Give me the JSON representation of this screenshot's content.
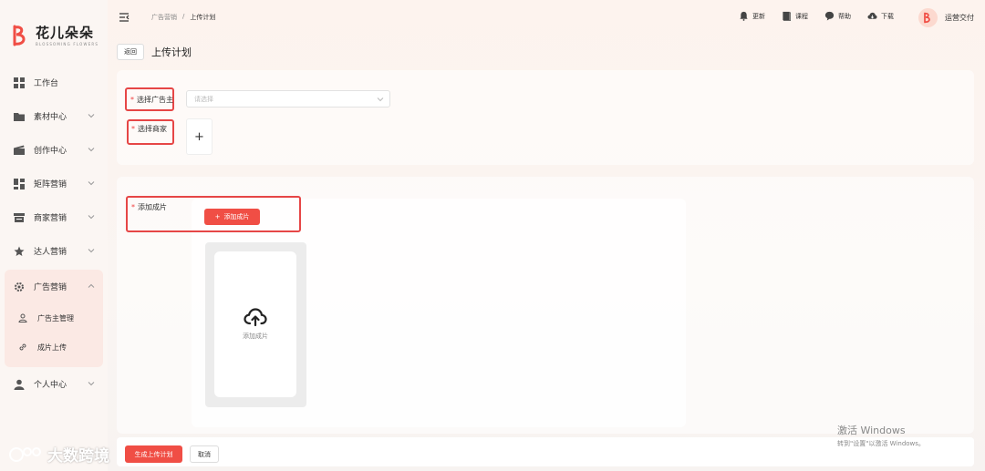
{
  "brand": {
    "name": "花儿朵朵",
    "subtitle": "BLOSSOMING FLOWERS",
    "accent": "#f04e45"
  },
  "sidebar": {
    "items": [
      {
        "label": "工作台",
        "icon": "grid-icon"
      },
      {
        "label": "素材中心",
        "icon": "folder-icon"
      },
      {
        "label": "创作中心",
        "icon": "clapperboard-icon"
      },
      {
        "label": "矩阵营销",
        "icon": "matrix-icon"
      },
      {
        "label": "商家营销",
        "icon": "store-icon"
      },
      {
        "label": "达人营销",
        "icon": "star-icon"
      },
      {
        "label": "广告营销",
        "icon": "gear-icon",
        "expanded": true,
        "children": [
          {
            "label": "广告主管理",
            "icon": "person-icon"
          },
          {
            "label": "成片上传",
            "icon": "link-icon"
          }
        ]
      },
      {
        "label": "个人中心",
        "icon": "user-icon"
      }
    ]
  },
  "header": {
    "breadcrumb": [
      "广告营销",
      "/",
      "上传计划"
    ],
    "actions": [
      {
        "label": "更新",
        "icon": "bell-icon"
      },
      {
        "label": "课程",
        "icon": "book-icon"
      },
      {
        "label": "帮助",
        "icon": "chat-icon"
      },
      {
        "label": "下载",
        "icon": "cloud-download-icon"
      }
    ],
    "user": "运营交付"
  },
  "page": {
    "back_label": "返回",
    "title": "上传计划"
  },
  "form": {
    "advertiser_label": "选择广告主",
    "advertiser_placeholder": "请选择",
    "merchant_label": "选择商家",
    "add_symbol": "+",
    "clip_label": "添加成片",
    "add_clip_button": "添加成片",
    "upload_text": "添加成片"
  },
  "footer": {
    "submit_label": "生成上传计划",
    "cancel_label": "取消"
  },
  "overlay": {
    "brand_watermark": "大数跨境",
    "activate_title": "激活 Windows",
    "activate_sub": "转到\"设置\"以激活 Windows。"
  }
}
